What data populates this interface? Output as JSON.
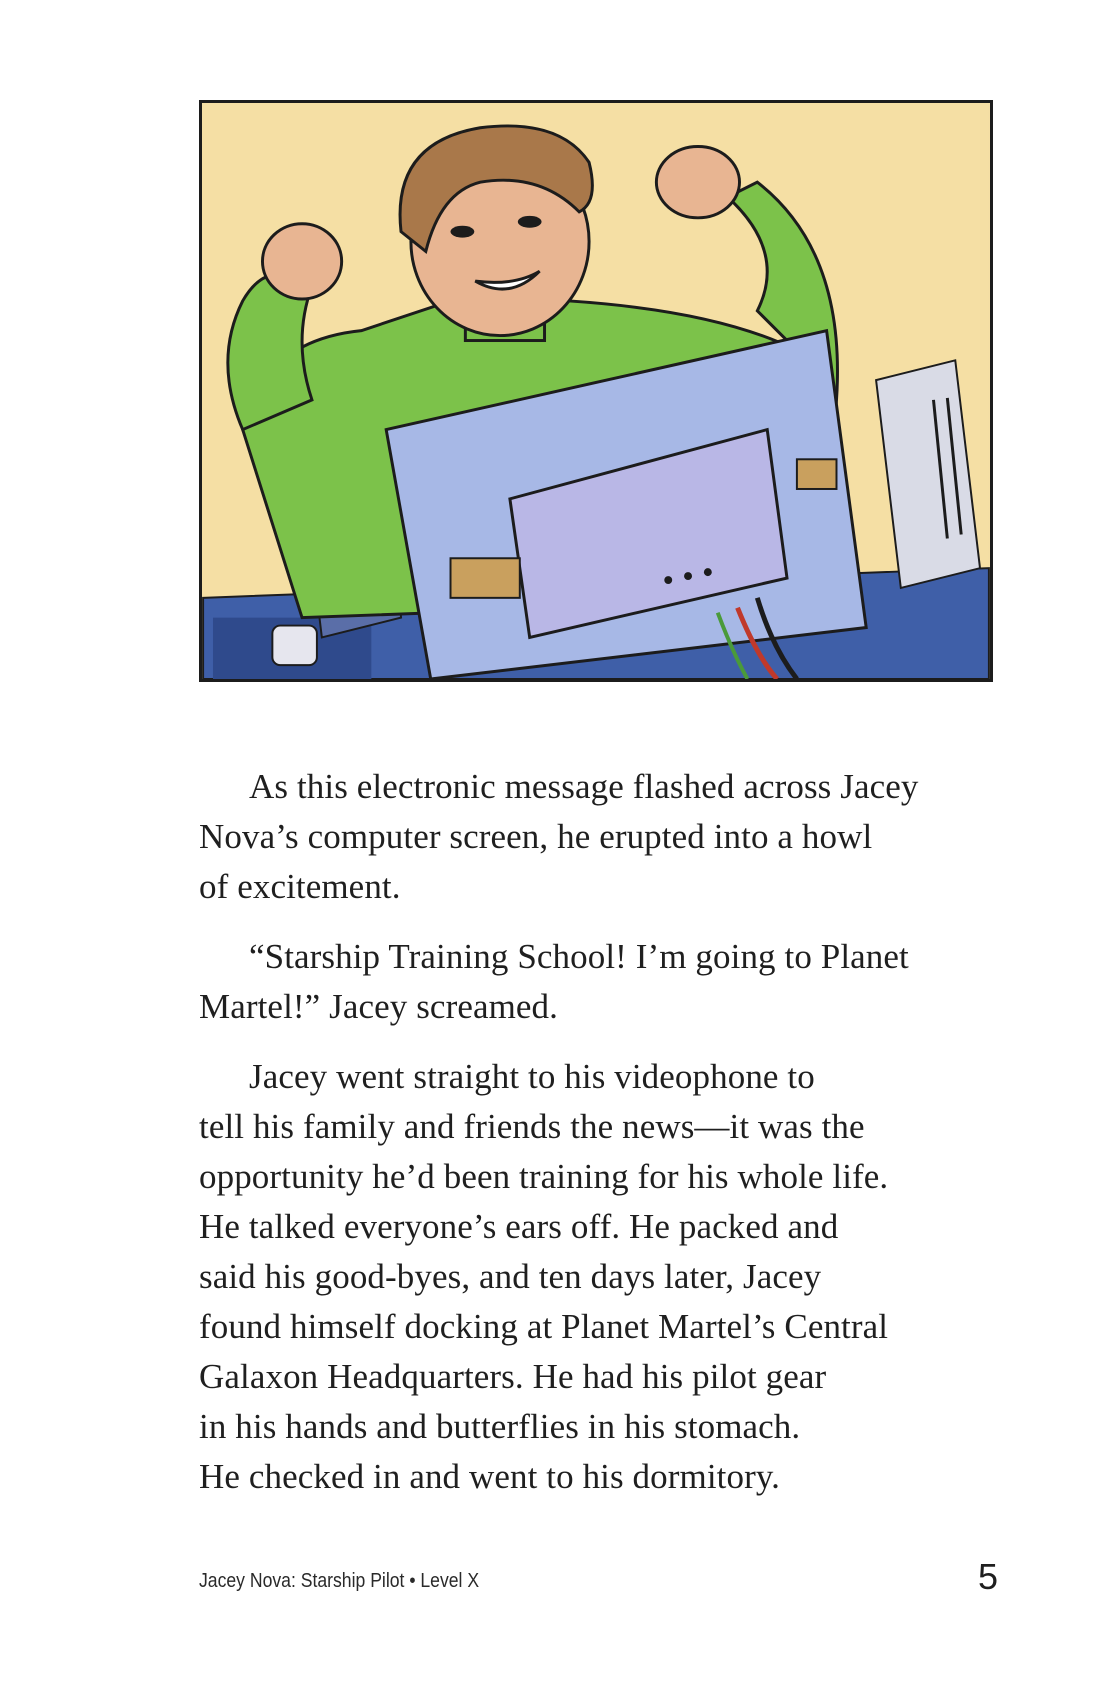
{
  "illustration": {
    "subject": "boy-cheering-at-computer",
    "colors": {
      "background": "#f5dfa4",
      "shirt": "#7cc24a",
      "shirt_shadow": "#5d9e35",
      "hair": "#a9784a",
      "skin": "#e8b592",
      "computer": "#a7b8e6",
      "computer_dark": "#8193cf",
      "desk": "#3f5fa8",
      "outline": "#1c1c1c"
    }
  },
  "paragraphs": [
    {
      "lines": [
        "As this electronic message flashed across Jacey",
        "Nova’s computer screen, he erupted into a howl",
        "of excitement."
      ]
    },
    {
      "lines": [
        "“Starship Training School! I’m going to Planet",
        "Martel!” Jacey screamed."
      ]
    },
    {
      "lines": [
        "Jacey went straight to his videophone to",
        "tell his family and friends the news—it was the",
        "opportunity he’d been training for his whole life.",
        "He talked everyone’s ears off. He packed and",
        "said his good-byes, and ten days later, Jacey",
        "found himself docking at Planet Martel’s Central",
        "Galaxon Headquarters. He had his pilot gear",
        "in his hands and butterflies in his stomach.",
        "He checked in and went to his dormitory."
      ]
    }
  ],
  "footer": {
    "book_title": "Jacey Nova: Starship Pilot • Level X",
    "page_number": "5"
  }
}
